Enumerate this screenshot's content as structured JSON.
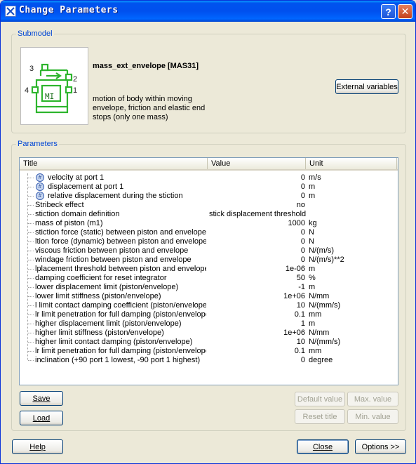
{
  "window": {
    "title": "Change Parameters",
    "help_glyph": "?",
    "close_glyph": "✕"
  },
  "submodel": {
    "legend": "Submodel",
    "name": "mass_ext_envelope [MAS31]",
    "description": "motion of body within moving envelope, friction and elastic end stops (only one mass)",
    "external_variables_label": "External variables",
    "diagram": {
      "port1": "1",
      "port2": "2",
      "port3": "3",
      "port4": "4",
      "block_label": "MI"
    }
  },
  "parameters": {
    "legend": "Parameters",
    "columns": {
      "title": "Title",
      "value": "Value",
      "unit": "Unit"
    },
    "rows": [
      {
        "title": "velocity at port 1",
        "value": "0",
        "unit": "m/s",
        "badge": "#"
      },
      {
        "title": "displacement at port 1",
        "value": "0",
        "unit": "m",
        "badge": "#"
      },
      {
        "title": "relative displacement during the stiction",
        "value": "0",
        "unit": "m",
        "badge": "#"
      },
      {
        "title": "Stribeck effect",
        "value": "no",
        "unit": ""
      },
      {
        "title": "stiction domain definition",
        "value": "stick displacement threshold",
        "unit": ""
      },
      {
        "title": "mass of piston (m1)",
        "value": "1000",
        "unit": "kg"
      },
      {
        "title": "stiction force (static) between piston and envelope",
        "value": "0",
        "unit": "N"
      },
      {
        "title": "ltion force (dynamic) between piston and envelope",
        "value": "0",
        "unit": "N"
      },
      {
        "title": "viscous friction between piston and envelope",
        "value": "0",
        "unit": "N/(m/s)"
      },
      {
        "title": "windage friction between piston and envelope",
        "value": "0",
        "unit": "N/(m/s)**2"
      },
      {
        "title": "lplacement threshold between piston and envelope",
        "value": "1e-06",
        "unit": "m"
      },
      {
        "title": "damping coefficient for reset integrator",
        "value": "50",
        "unit": "%"
      },
      {
        "title": "lower displacement limit (piston/envelope)",
        "value": "-1",
        "unit": "m"
      },
      {
        "title": "lower limit stiffness (piston/envelope)",
        "value": "1e+06",
        "unit": "N/mm"
      },
      {
        "title": "l limit contact damping coefficient (piston/envelope)",
        "value": "10",
        "unit": "N/(mm/s)"
      },
      {
        "title": "lr limit penetration for full damping (piston/envelope)",
        "value": "0.1",
        "unit": "mm"
      },
      {
        "title": "higher displacement limit (piston/envelope)",
        "value": "1",
        "unit": "m"
      },
      {
        "title": "higher limit stiffness (piston/envelope)",
        "value": "1e+06",
        "unit": "N/mm"
      },
      {
        "title": "higher limit contact damping (piston/envelope)",
        "value": "10",
        "unit": "N/(mm/s)"
      },
      {
        "title": "lr limit penetration for full damping (piston/envelope)",
        "value": "0.1",
        "unit": "mm"
      },
      {
        "title": "inclination (+90 port 1 lowest, -90 port 1 highest)",
        "value": "0",
        "unit": "degree"
      }
    ],
    "buttons": {
      "save": "Save",
      "load": "Load",
      "default_value": "Default value",
      "max_value": "Max. value",
      "reset_title": "Reset title",
      "min_value": "Min. value"
    }
  },
  "footer": {
    "help": "Help",
    "close": "Close",
    "options": "Options >>"
  }
}
